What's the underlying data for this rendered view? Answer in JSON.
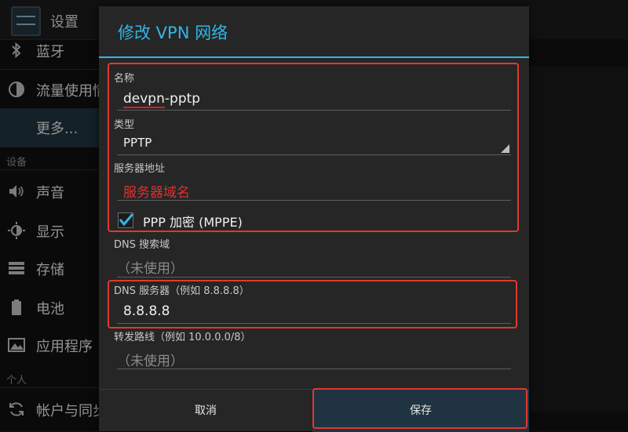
{
  "app": {
    "title": "设置"
  },
  "sidebar": {
    "items": [
      {
        "label": "蓝牙",
        "icon": "bluetooth-icon"
      },
      {
        "label": "流量使用情",
        "icon": "data-usage-icon"
      },
      {
        "label": "更多...",
        "icon": ""
      },
      {
        "label": "声音",
        "icon": "volume-icon"
      },
      {
        "label": "显示",
        "icon": "brightness-icon"
      },
      {
        "label": "存储",
        "icon": "storage-icon"
      },
      {
        "label": "电池",
        "icon": "battery-icon"
      },
      {
        "label": "应用程序",
        "icon": "apps-icon"
      },
      {
        "label": "帐户与同步",
        "icon": "sync-icon"
      }
    ],
    "sections": {
      "device": "设备",
      "personal": "个人"
    }
  },
  "dialog": {
    "title": "修改 VPN 网络",
    "name": {
      "label": "名称",
      "value": "devpn-pptp",
      "underlined_part": "devpn"
    },
    "type": {
      "label": "类型",
      "value": "PPTP"
    },
    "server": {
      "label": "服务器地址",
      "value": "服务器域名"
    },
    "encryption": {
      "label": "PPP 加密 (MPPE)",
      "checked": true
    },
    "dns_search": {
      "label": "DNS 搜索域",
      "placeholder": "（未使用）"
    },
    "dns_server": {
      "label": "DNS 服务器（例如 8.8.8.8）",
      "value": "8.8.8.8"
    },
    "routes": {
      "label": "转发路线（例如 10.0.0.0/8）",
      "placeholder": "（未使用）"
    },
    "buttons": {
      "cancel": "取消",
      "save": "保存"
    }
  },
  "colors": {
    "accent": "#33b5e5",
    "highlight": "#e0382f",
    "server_text": "#e03030"
  }
}
